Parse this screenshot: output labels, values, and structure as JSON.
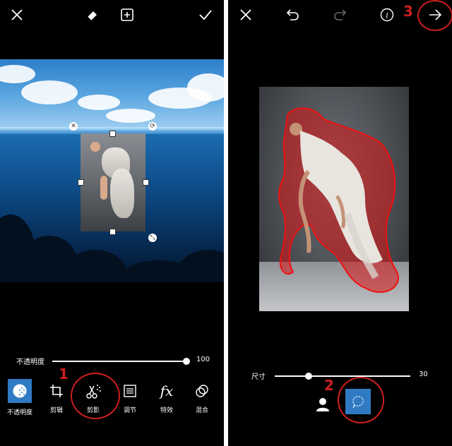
{
  "left": {
    "topbar": {
      "close": "close-icon",
      "eraser": "eraser-icon",
      "add": "add-icon",
      "confirm": "check-icon"
    },
    "opacity": {
      "label": "不透明度",
      "value": "100",
      "level_percent": 100
    },
    "tools": [
      {
        "label": "不透明度",
        "icon": "opacity-icon",
        "active": true
      },
      {
        "label": "剪辑",
        "icon": "crop-icon",
        "active": false
      },
      {
        "label": "剪影",
        "icon": "cutout-icon",
        "active": false
      },
      {
        "label": "调节",
        "icon": "adjust-icon",
        "active": false
      },
      {
        "label": "特效",
        "icon": "fx-icon",
        "active": false
      },
      {
        "label": "混合",
        "icon": "blend-icon",
        "active": false
      }
    ],
    "annotation": "1"
  },
  "right": {
    "topbar": {
      "close": "close-icon",
      "undo": "undo-icon",
      "redo": "redo-icon",
      "info": "info-icon",
      "next": "arrow-right-icon"
    },
    "size": {
      "label": "尺寸",
      "value": "30",
      "level_percent": 25
    },
    "tools": [
      {
        "icon": "person-icon",
        "active": false
      },
      {
        "icon": "lasso-icon",
        "active": true
      }
    ],
    "annotations": [
      "2",
      "3"
    ]
  },
  "colors": {
    "accent": "#2f7ac3",
    "annotation": "#cc1f1f",
    "background": "#000000"
  }
}
